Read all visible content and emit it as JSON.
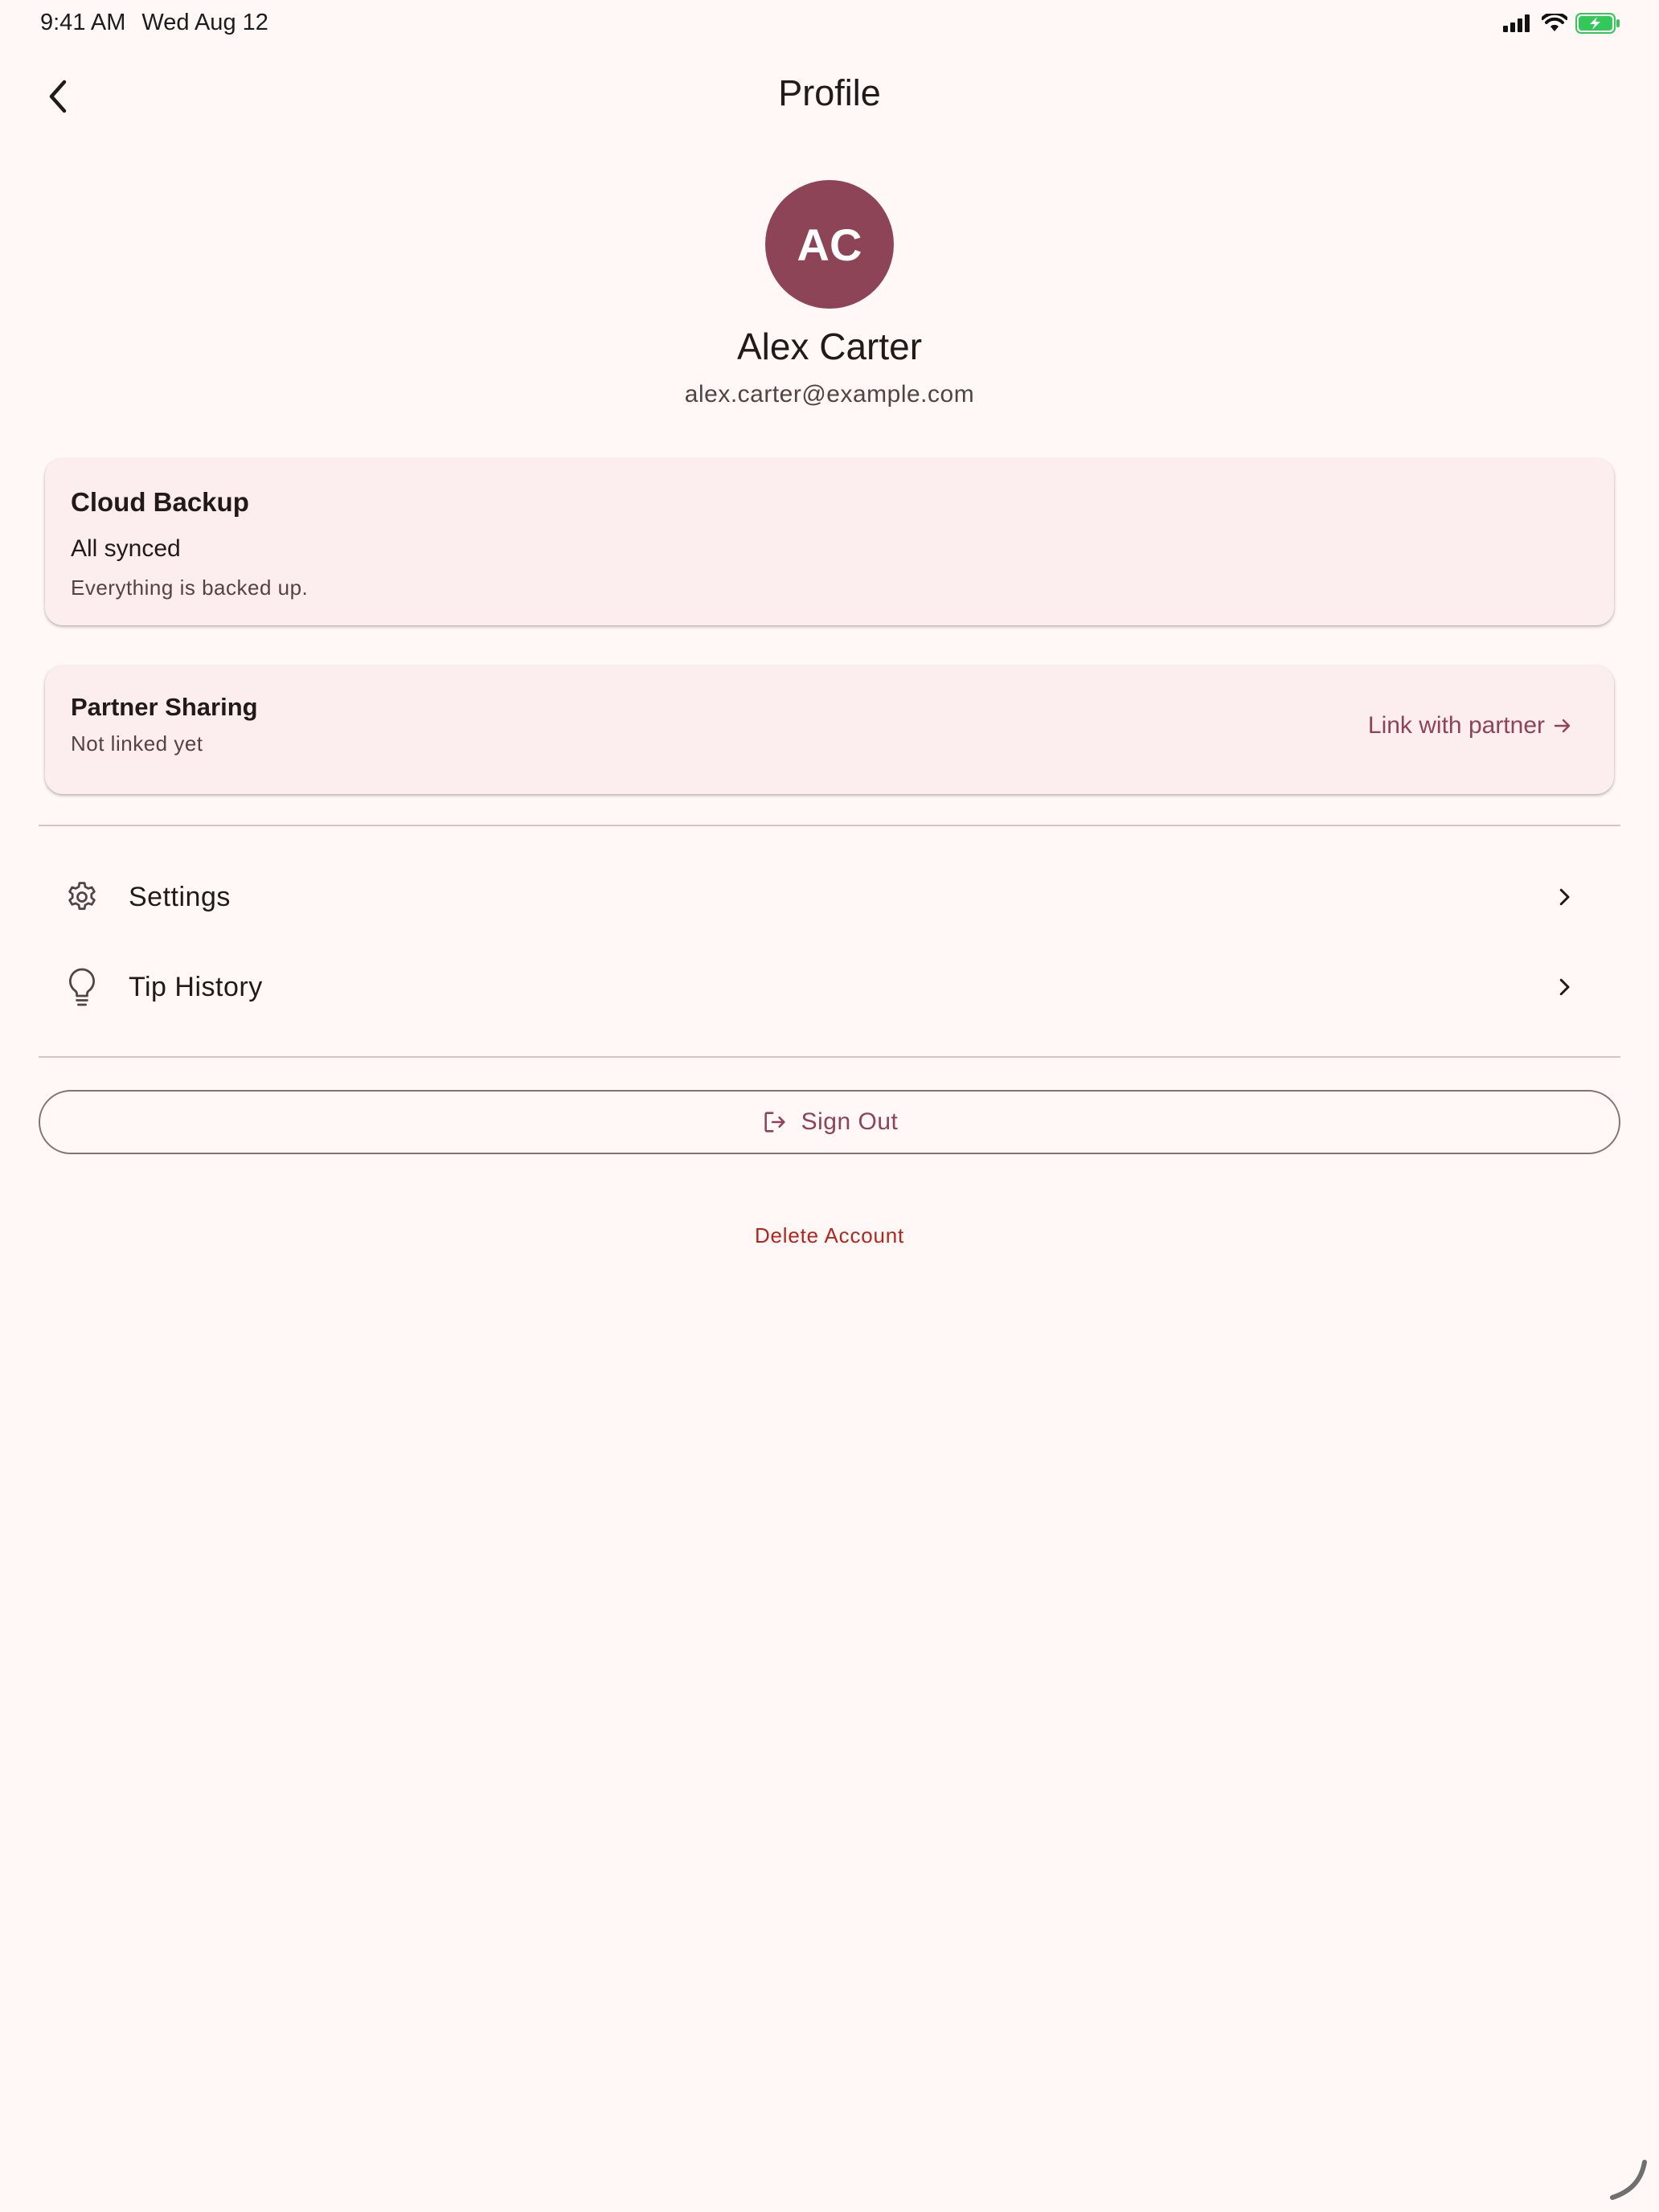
{
  "status_bar": {
    "time": "9:41 AM",
    "date": "Wed Aug 12"
  },
  "header": {
    "title": "Profile"
  },
  "user": {
    "initials": "AC",
    "name": "Alex Carter",
    "email": "alex.carter@example.com"
  },
  "cloud_backup": {
    "title": "Cloud Backup",
    "status": "All synced",
    "subtitle": "Everything is backed up."
  },
  "partner_sharing": {
    "title": "Partner Sharing",
    "status": "Not linked yet",
    "link_label": "Link with partner"
  },
  "menu": {
    "items": [
      {
        "label": "Settings",
        "icon": "gear-icon"
      },
      {
        "label": "Tip History",
        "icon": "lightbulb-icon"
      }
    ]
  },
  "actions": {
    "sign_out": "Sign Out",
    "delete_account": "Delete Account"
  },
  "colors": {
    "background": "#FFF8F6",
    "primary": "#8C4456",
    "card": "#FCEEEE",
    "error": "#B3261E"
  }
}
